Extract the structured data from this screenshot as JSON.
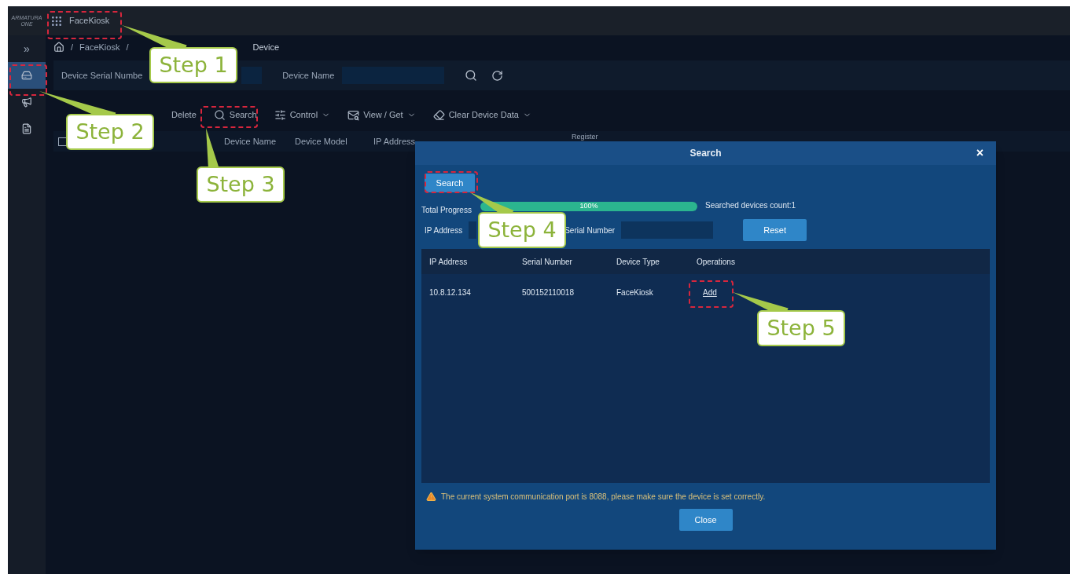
{
  "header": {
    "logo": [
      "ARMATURA",
      "ONE"
    ],
    "app_name": "FaceKiosk"
  },
  "breadcrumb": [
    {
      "kind": "sep",
      "text": "/"
    },
    {
      "kind": "link",
      "text": "FaceKiosk"
    },
    {
      "kind": "sep",
      "text": "/"
    },
    {
      "kind": "current",
      "text": "Device"
    }
  ],
  "sidebar": {
    "expand": "»",
    "items": [
      {
        "selected": true
      },
      {
        "selected": false
      },
      {
        "selected": false
      }
    ]
  },
  "filters": [
    {
      "label": "Device Serial Numbe"
    },
    {
      "label": "Device Name"
    }
  ],
  "toolbar": [
    {
      "label": "Delete",
      "dropdown": false
    },
    {
      "label": "Search",
      "dropdown": false
    },
    {
      "label": "Control",
      "dropdown": true
    },
    {
      "label": "View / Get",
      "dropdown": true
    },
    {
      "label": "Clear Device Data",
      "dropdown": true
    }
  ],
  "table": {
    "checked": false,
    "columns": [
      "Device Name",
      "Device Model",
      "IP Address",
      "Register"
    ]
  },
  "modal": {
    "title": "Search",
    "close": "×",
    "search_button": "Search",
    "progress_label": "Total Progress",
    "level": 1,
    "reading": "100%",
    "count": "Searched devices count:1",
    "fields": [
      {
        "label": "IP Address"
      },
      {
        "label": "Serial Number"
      }
    ],
    "reset": "Reset",
    "columns": [
      "IP Address",
      "Serial Number",
      "Device Type",
      "Operations"
    ],
    "rows": [
      {
        "ip": "10.8.12.134",
        "serial": "500152110018",
        "type": "FaceKiosk",
        "action": "Add"
      }
    ],
    "warning": "The current system communication port is 8088, please make sure the device is set correctly.",
    "close_button": "Close"
  },
  "annotations": [
    "Step 1",
    "Step 2",
    "Step 3",
    "Step 4",
    "Step 5"
  ]
}
